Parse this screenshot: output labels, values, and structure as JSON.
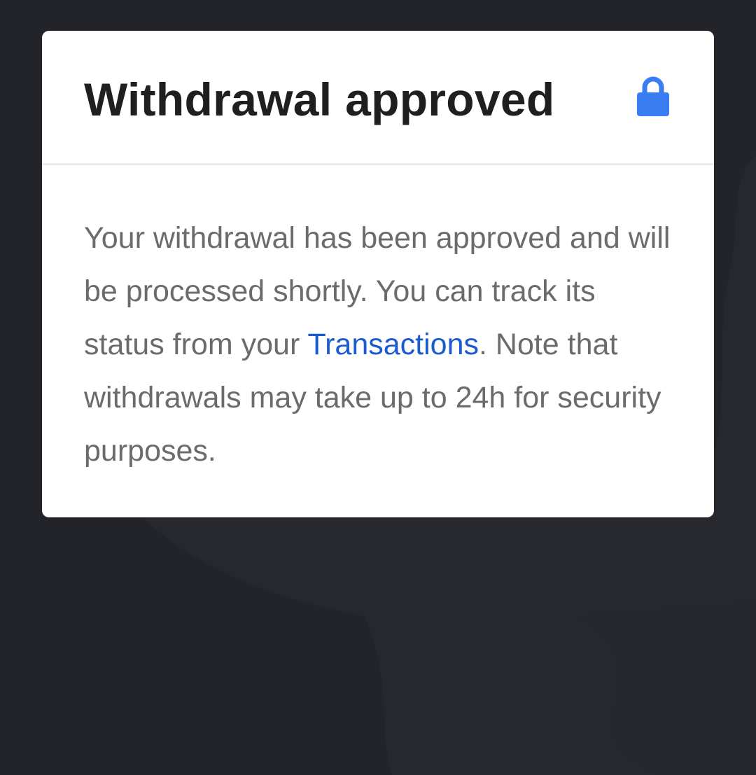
{
  "dialog": {
    "title": "Withdrawal approved",
    "header_icon": "lock-icon",
    "message": {
      "before_link": "Your withdrawal has been approved and will be processed shortly. You can track its status from your ",
      "link_text": "Transactions",
      "after_link": ". Note that withdrawals may take up to 24h for security purposes."
    }
  },
  "colors": {
    "backdrop": "#222429",
    "card": "#ffffff",
    "title": "#1f1f1f",
    "body_text": "#6b6b6b",
    "link": "#1a5bd1",
    "icon_accent": "#3a7cf2"
  }
}
